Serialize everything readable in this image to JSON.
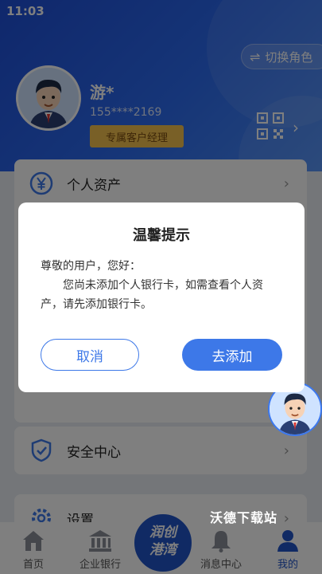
{
  "status_bar": {
    "time": "11:03"
  },
  "header": {
    "switch_role_label": "切换角色",
    "username": "游*",
    "phone": "155****2169",
    "manager_badge": "专属客户经理"
  },
  "menu": [
    {
      "label": "个人资产",
      "icon": "yen-icon"
    },
    {
      "label": "安全中心",
      "icon": "shield-icon"
    },
    {
      "label": "设置",
      "icon": "gear-icon"
    }
  ],
  "dialog": {
    "title": "温馨提示",
    "greeting": "尊敬的用户，您好：",
    "message": "您尚未添加个人银行卡，如需查看个人资产，请先添加银行卡。",
    "cancel_label": "取消",
    "confirm_label": "去添加"
  },
  "tabbar": {
    "items": [
      {
        "label": "首页",
        "icon": "home-icon"
      },
      {
        "label": "企业银行",
        "icon": "bank-icon"
      },
      {
        "label": "消息中心",
        "icon": "bell-icon"
      },
      {
        "label": "我的",
        "icon": "user-icon"
      }
    ],
    "center_logo_line1": "润创",
    "center_logo_line2": "港湾"
  },
  "watermark": "沃德下载站",
  "colors": {
    "primary": "#3d78e8",
    "header_blue": "#2c6bf0",
    "badge_gold": "#f2c14e"
  }
}
